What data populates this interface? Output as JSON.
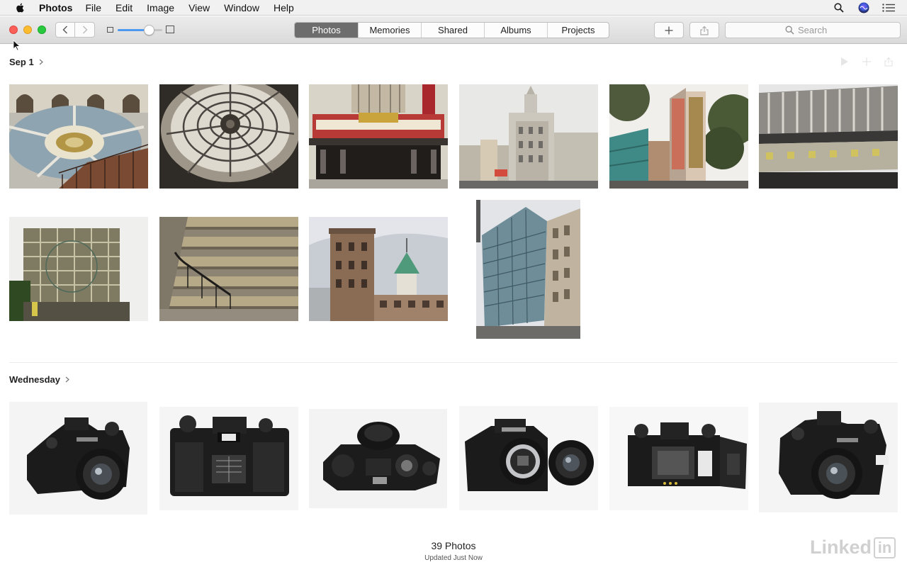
{
  "menubar": {
    "app_name": "Photos",
    "items": [
      "File",
      "Edit",
      "Image",
      "View",
      "Window",
      "Help"
    ],
    "right_icons": [
      "spotlight-icon",
      "siri-icon",
      "notification-center-icon"
    ]
  },
  "toolbar": {
    "traffic_lights": [
      "close",
      "minimize",
      "maximize"
    ],
    "zoom_level_fraction": 0.7,
    "tabs": [
      {
        "label": "Photos",
        "active": true
      },
      {
        "label": "Memories",
        "active": false
      },
      {
        "label": "Shared",
        "active": false
      },
      {
        "label": "Albums",
        "active": false
      },
      {
        "label": "Projects",
        "active": false
      }
    ],
    "search": {
      "placeholder": "Search",
      "value": ""
    }
  },
  "sections": [
    {
      "title": "Sep 1",
      "photos": [
        {
          "subject": "rotunda-staircase-photo"
        },
        {
          "subject": "glass-dome-photo"
        },
        {
          "subject": "theater-marquee-photo"
        },
        {
          "subject": "city-street-tower-photo"
        },
        {
          "subject": "art-deco-theater-photo"
        },
        {
          "subject": "building-facade-photo"
        },
        {
          "subject": "window-reflection-photo"
        },
        {
          "subject": "stairs-railing-photo"
        },
        {
          "subject": "clock-tower-photo"
        },
        {
          "subject": "glass-skyscraper-photo"
        }
      ]
    },
    {
      "title": "Wednesday",
      "photos": [
        {
          "subject": "camera-front-photo"
        },
        {
          "subject": "camera-back-photo"
        },
        {
          "subject": "camera-top-photo"
        },
        {
          "subject": "camera-body-lens-photo"
        },
        {
          "subject": "camera-open-back-photo"
        },
        {
          "subject": "camera-angle-photo"
        }
      ]
    }
  ],
  "footer": {
    "photo_count": "39 Photos",
    "status": "Updated Just Now"
  },
  "watermark": {
    "text": "Linked",
    "badge": "in"
  },
  "colors": {
    "accent": "#4e9af1",
    "active_tab": "#6d6d6d",
    "close": "#fc5f57",
    "minimize": "#fdbc2e",
    "maximize": "#28c840"
  }
}
